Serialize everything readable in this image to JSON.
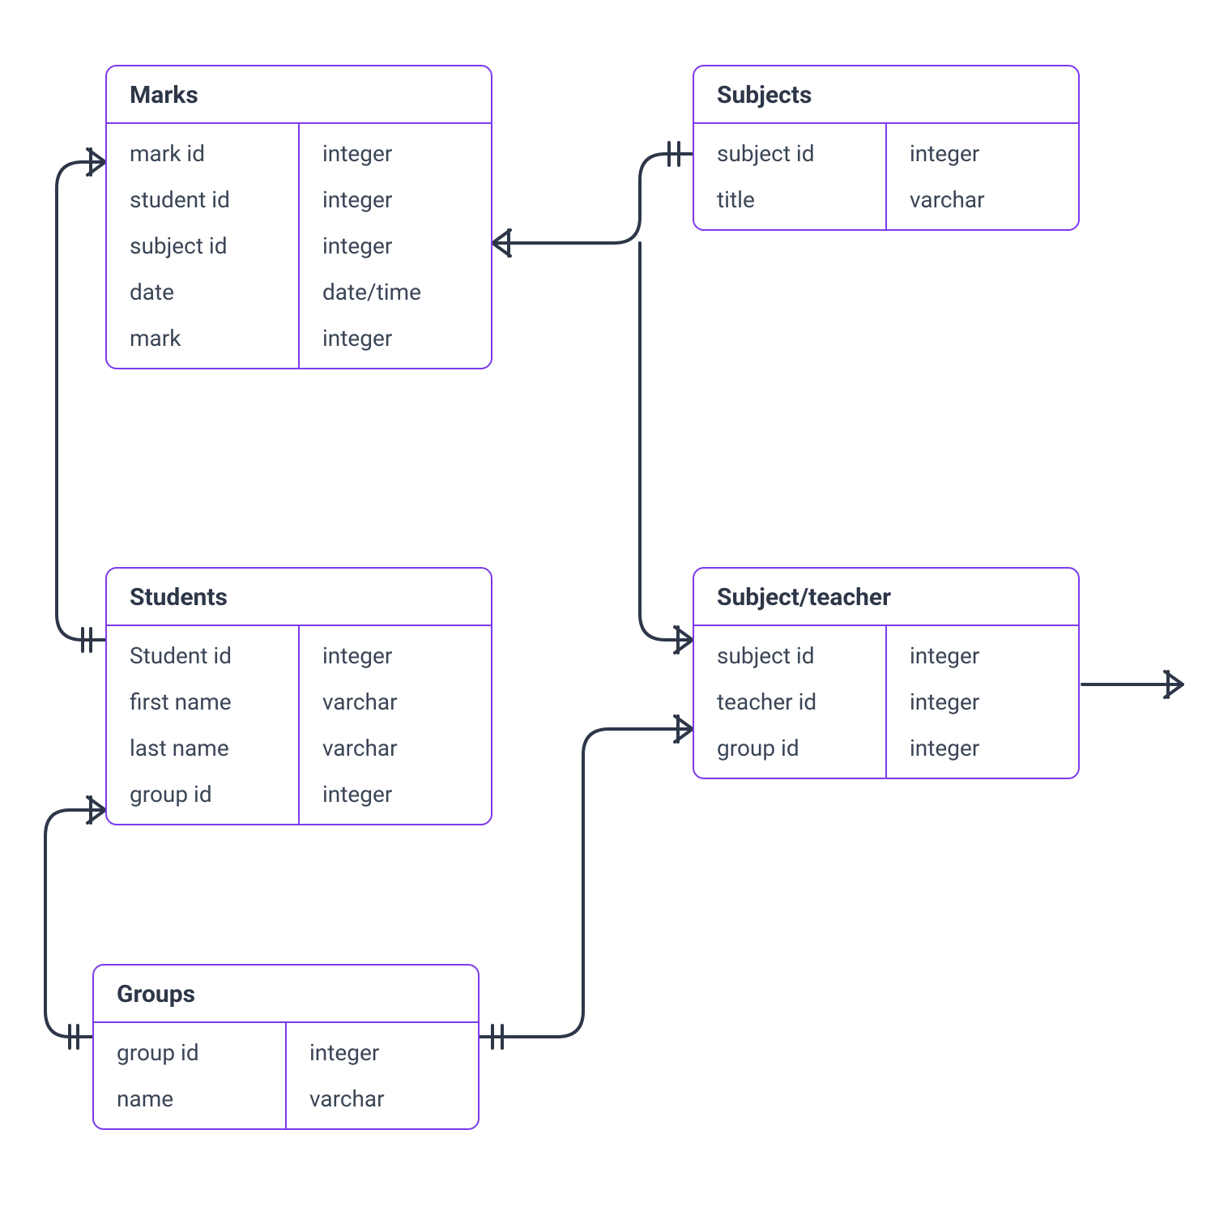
{
  "entities": {
    "marks": {
      "title": "Marks",
      "fields": [
        {
          "name": "mark id",
          "type": "integer"
        },
        {
          "name": "student id",
          "type": "integer"
        },
        {
          "name": "subject id",
          "type": "integer"
        },
        {
          "name": "date",
          "type": "date/time"
        },
        {
          "name": "mark",
          "type": "integer"
        }
      ]
    },
    "subjects": {
      "title": "Subjects",
      "fields": [
        {
          "name": "subject id",
          "type": "integer"
        },
        {
          "name": "title",
          "type": "varchar"
        }
      ]
    },
    "students": {
      "title": "Students",
      "fields": [
        {
          "name": "Student id",
          "type": "integer"
        },
        {
          "name": "first name",
          "type": "varchar"
        },
        {
          "name": "last name",
          "type": "varchar"
        },
        {
          "name": "group id",
          "type": "integer"
        }
      ]
    },
    "subject_teacher": {
      "title": "Subject/teacher",
      "fields": [
        {
          "name": "subject id",
          "type": "integer"
        },
        {
          "name": "teacher id",
          "type": "integer"
        },
        {
          "name": "group id",
          "type": "integer"
        }
      ]
    },
    "groups": {
      "title": "Groups",
      "fields": [
        {
          "name": "group id",
          "type": "integer"
        },
        {
          "name": "name",
          "type": "varchar"
        }
      ]
    }
  },
  "relationships": [
    {
      "from": "students",
      "to": "marks",
      "notation": "one-to-many"
    },
    {
      "from": "subjects",
      "to": "marks",
      "notation": "one-to-many"
    },
    {
      "from": "groups",
      "to": "students",
      "notation": "one-to-many"
    },
    {
      "from": "subjects",
      "to": "subject_teacher",
      "notation": "one-to-many"
    },
    {
      "from": "groups",
      "to": "subject_teacher",
      "notation": "one-to-many"
    },
    {
      "from": "subject_teacher",
      "to": "external",
      "notation": "many"
    }
  ],
  "colors": {
    "border": "#7c3aed",
    "title_text": "#2d3748",
    "body_text": "#3a4556",
    "connector": "#2d3748"
  }
}
